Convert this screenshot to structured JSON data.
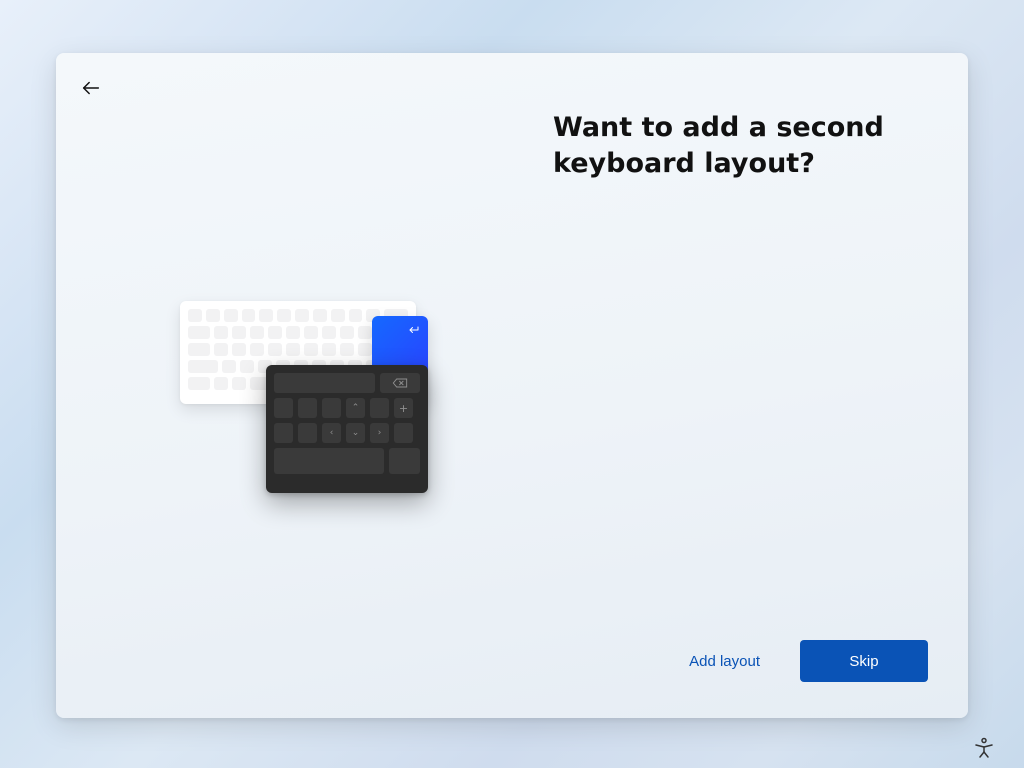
{
  "heading": "Want to add a second keyboard layout?",
  "buttons": {
    "add_layout": "Add layout",
    "skip": "Skip"
  },
  "icons": {
    "back": "back-arrow-icon",
    "accessibility": "accessibility-icon",
    "enter": "enter-icon",
    "erase": "erase-icon"
  },
  "colors": {
    "primary": "#0a53b6",
    "blue_tile_start": "#1569ff",
    "blue_tile_end": "#2e3bff"
  }
}
